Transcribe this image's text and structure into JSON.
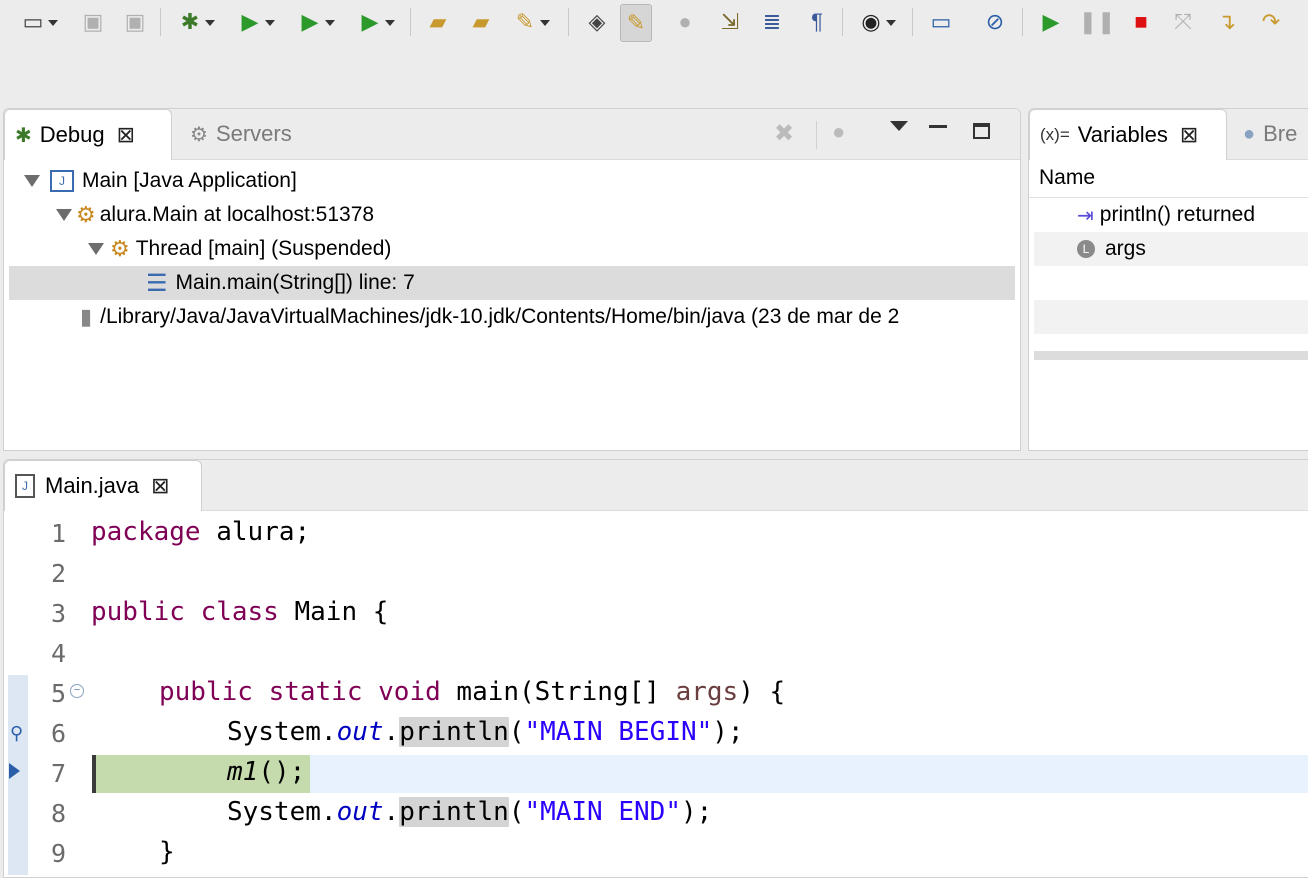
{
  "debug_view": {
    "tabs": [
      {
        "label": "Debug",
        "close": "⊠"
      },
      {
        "label": "Servers"
      }
    ],
    "tree": [
      {
        "label": "Main [Java Application]"
      },
      {
        "label": "alura.Main at localhost:51378"
      },
      {
        "label": "Thread [main] (Suspended)"
      },
      {
        "label": "Main.main(String[]) line: 7"
      },
      {
        "label": "/Library/Java/JavaVirtualMachines/jdk-10.jdk/Contents/Home/bin/java (23 de mar de 2"
      }
    ]
  },
  "variables_view": {
    "tab_label": "Variables",
    "tab_prefix": "(x)=",
    "next_tab": "Bre",
    "column_header": "Name",
    "rows": [
      {
        "label": "println() returned"
      },
      {
        "label": "args"
      }
    ]
  },
  "editor": {
    "tab_label": "Main.java",
    "line_numbers": [
      "1",
      "2",
      "3",
      "4",
      "5",
      "6",
      "7",
      "8",
      "9"
    ],
    "lines": {
      "l1_kw": "package",
      "l1_rest": " alura;",
      "l3_kw": "public class",
      "l3_rest": " Main {",
      "l5_kw": "public static void",
      "l5_rest": " main(String[] ",
      "l5_param": "args",
      "l5_end": ") {",
      "l6_sys": "System.",
      "l6_out": "out",
      "l6_dot": ".",
      "l6_method": "println",
      "l6_open": "(",
      "l6_str": "\"MAIN BEGIN\"",
      "l6_close": ");",
      "l7_call": "m1",
      "l7_rest": "();",
      "l8_sys": "System.",
      "l8_out": "out",
      "l8_dot": ".",
      "l8_method": "println",
      "l8_open": "(",
      "l8_str": "\"MAIN END\"",
      "l8_close": ");",
      "l9": "}"
    },
    "current_line": 7
  },
  "colors": {
    "keyword": "#7f0055",
    "string": "#2a00ff",
    "field": "#0000c0",
    "current_line_bg": "#e8f2fe",
    "instruction_pointer_bg": "#c5dbad"
  }
}
